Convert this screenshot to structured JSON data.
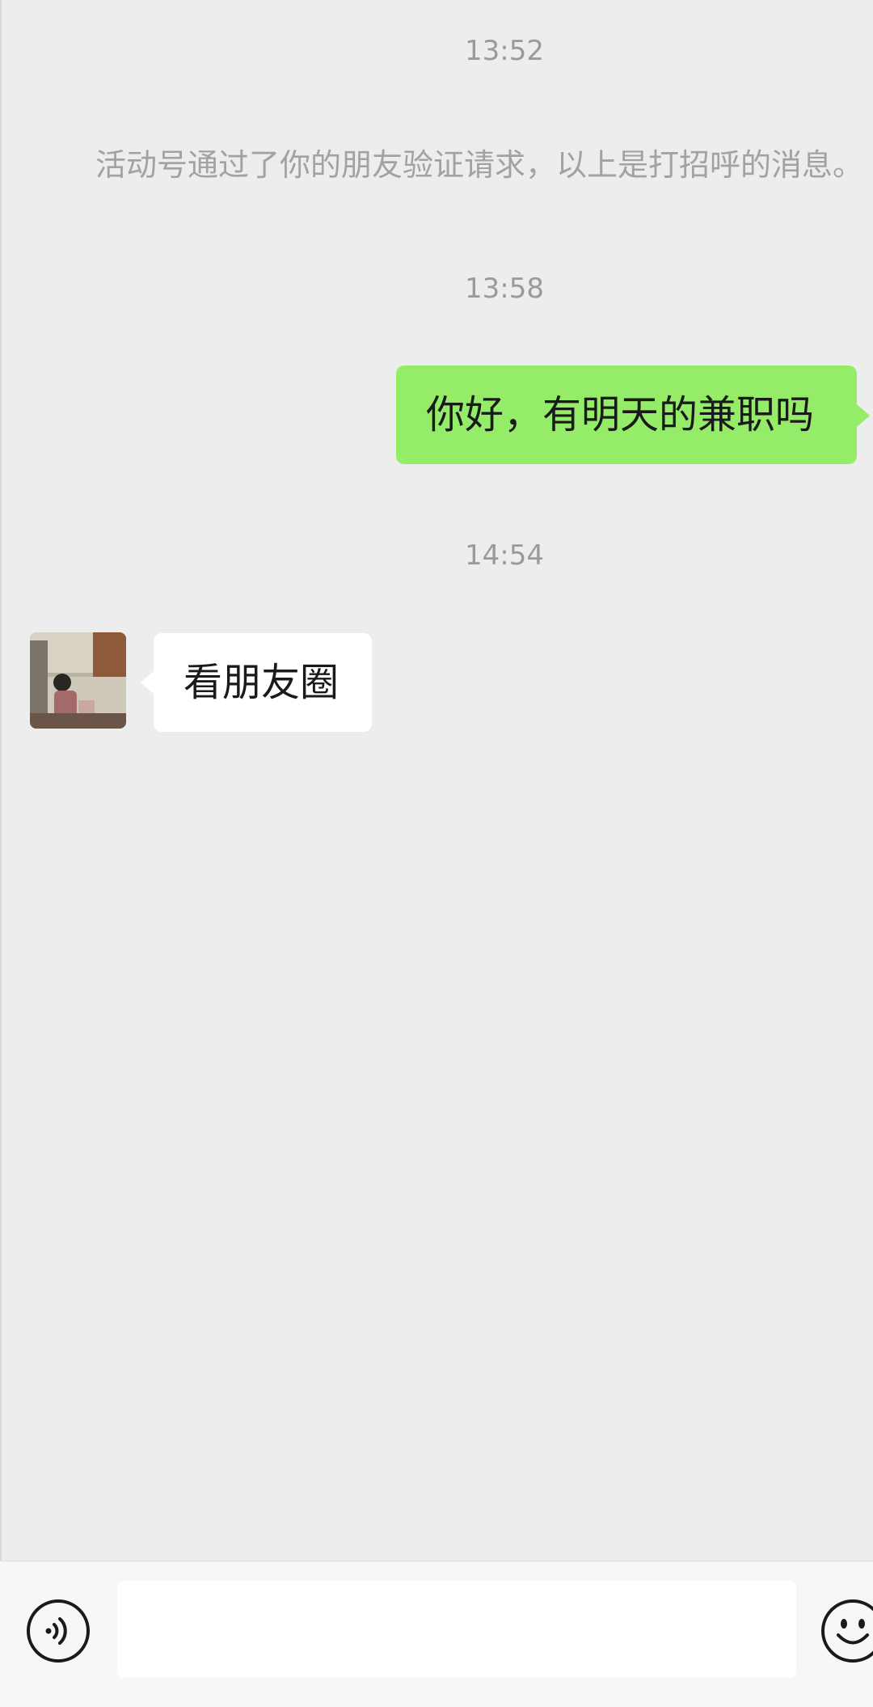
{
  "chat": {
    "timestamp_1": "13:52",
    "system_message": "活动号通过了你的朋友验证请求，以上是打招呼的消息。",
    "timestamp_2": "13:58",
    "sent_message": "你好，有明天的兼职吗",
    "timestamp_3": "14:54",
    "received_message": "看朋友圈"
  },
  "input_bar": {
    "text_value": "",
    "voice_icon": "voice-icon",
    "emoji_icon": "emoji-icon"
  },
  "colors": {
    "background": "#ededed",
    "sent_bubble": "#95ec69",
    "received_bubble": "#ffffff",
    "timestamp_text": "#9a9a9a"
  }
}
